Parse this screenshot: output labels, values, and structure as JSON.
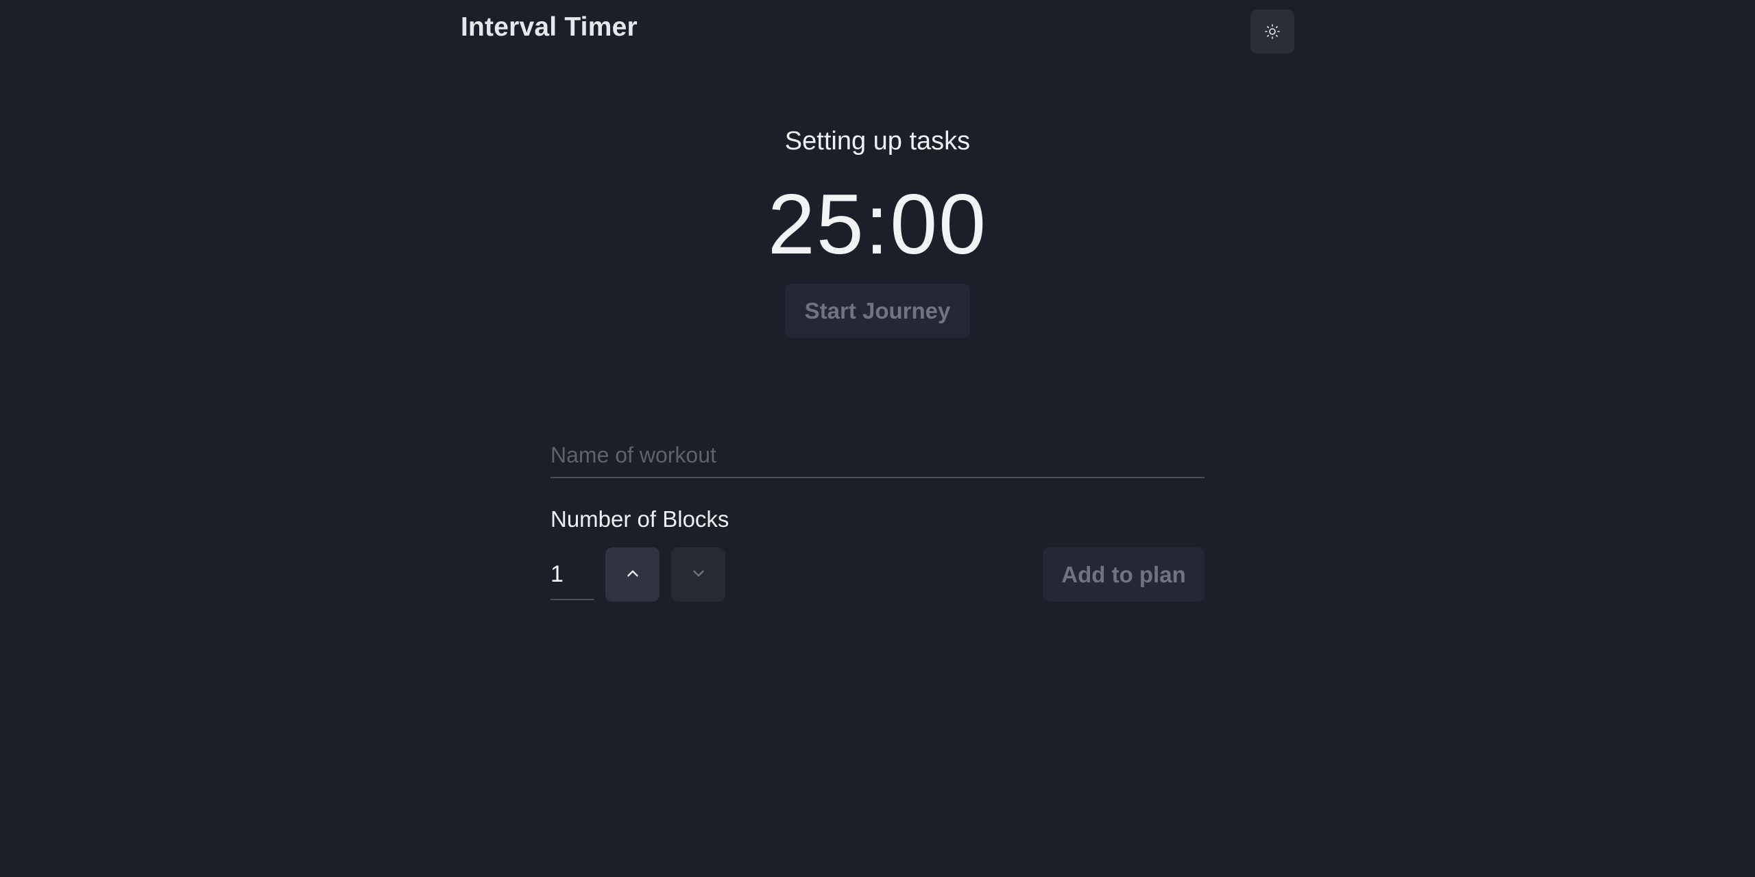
{
  "app": {
    "title": "Interval Timer"
  },
  "header": {
    "theme_toggle_icon": "sun-icon"
  },
  "timer": {
    "task_label": "Setting up tasks",
    "display": "25:00",
    "start_label": "Start Journey"
  },
  "form": {
    "name_placeholder": "Name of workout",
    "name_value": "",
    "blocks_label": "Number of Blocks",
    "blocks_value": "1",
    "increment_icon": "chevron-up-icon",
    "decrement_icon": "chevron-down-icon",
    "add_label": "Add to plan"
  },
  "colors": {
    "background": "#1b1f2a",
    "button_disabled_bg": "#242834",
    "button_disabled_text": "#6f7480",
    "text_primary": "#f3f4f6"
  }
}
